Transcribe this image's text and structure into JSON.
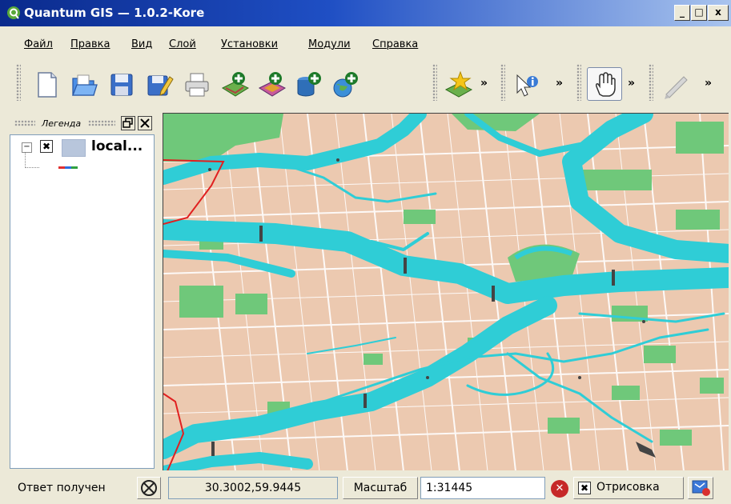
{
  "window": {
    "title": "Quantum GIS — 1.0.2-Kore",
    "buttons": [
      "_",
      "□",
      "x"
    ]
  },
  "menu": [
    "Файл",
    "Правка",
    "Вид",
    "Слой",
    "Установки",
    "Модули",
    "Справка"
  ],
  "toolbar": {
    "icons": [
      "new-project-icon",
      "open-project-icon",
      "save-project-icon",
      "save-as-icon",
      "print-icon",
      "add-vector-layer-icon",
      "add-raster-layer-icon",
      "add-postgis-layer-icon",
      "add-wms-layer-icon",
      "new-bookmark-icon",
      "identify-icon",
      "pan-icon",
      "digitize-icon"
    ],
    "overflow": "»"
  },
  "legend": {
    "title": "Легенда",
    "layer_name": "local...",
    "expand": "⊟",
    "check": "✖"
  },
  "status": {
    "message": "Ответ получен",
    "coordinates": "30.3002,59.9445",
    "scale_label": "Масштаб",
    "scale_value": "1:31445",
    "render_label": "Отрисовка",
    "render_check": "✖"
  },
  "colors": {
    "land": "#ecc9b0",
    "water": "#2fcdd6",
    "park": "#6fc87a",
    "road": "#ffffff",
    "boundary": "#e02020"
  }
}
